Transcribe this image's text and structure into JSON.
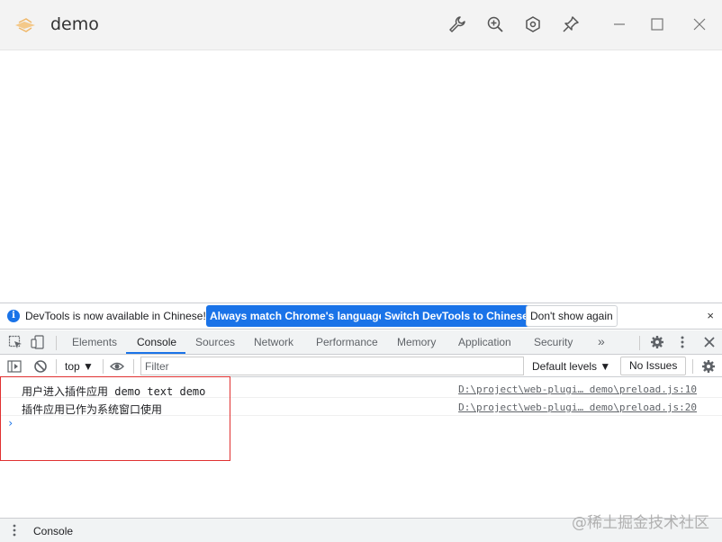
{
  "window": {
    "title": "demo",
    "controls": [
      "wrench-icon",
      "zoom-icon",
      "settings-hex-icon",
      "pin-icon",
      "minimize-icon",
      "maximize-icon",
      "close-icon"
    ]
  },
  "infobar": {
    "message": "DevTools is now available in Chinese!",
    "match_button": "Always match Chrome's language",
    "switch_button": "Switch DevTools to Chinese",
    "dismiss_button": "Don't show again",
    "close": "×"
  },
  "devtools_tabs": {
    "items": [
      "Elements",
      "Console",
      "Sources",
      "Network",
      "Performance",
      "Memory",
      "Application",
      "Security"
    ],
    "active": "Console",
    "more": "»"
  },
  "console_toolbar": {
    "context": "top ▼",
    "filter_placeholder": "Filter",
    "levels": "Default levels ▼",
    "issues": "No Issues"
  },
  "console_messages": [
    {
      "text": "用户进入插件应用 demo text demo",
      "source": "D:\\project\\web-plugi… demo\\preload.js:10"
    },
    {
      "text": "插件应用已作为系统窗口使用",
      "source": "D:\\project\\web-plugi… demo\\preload.js:20"
    }
  ],
  "console_prompt": "›",
  "drawer": {
    "tab": "Console"
  },
  "watermark": "@稀土掘金技术社区",
  "colors": {
    "accent": "#1a73e8",
    "highlight_box": "#e03131"
  }
}
